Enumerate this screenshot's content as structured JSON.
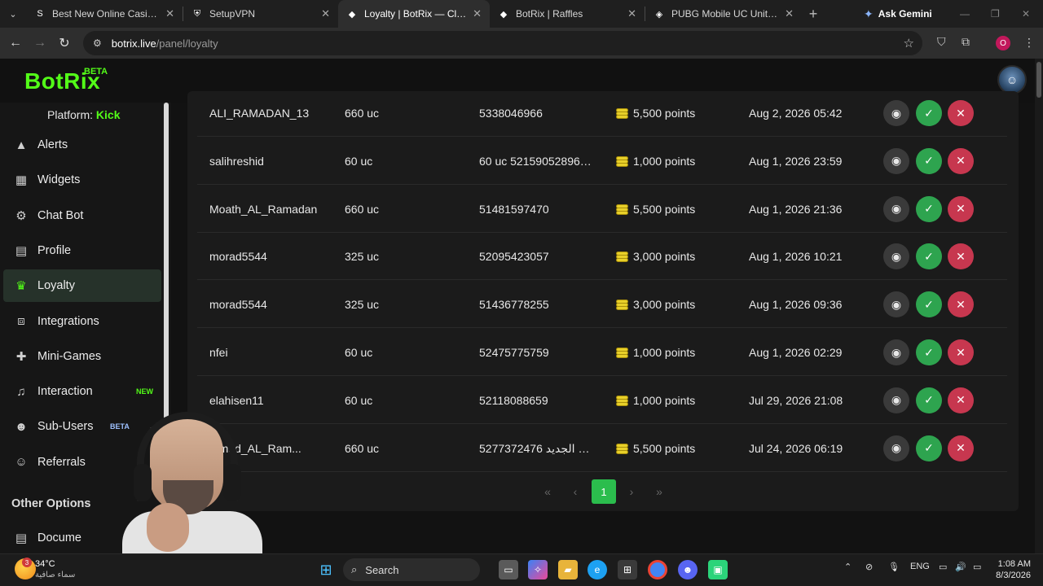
{
  "browser": {
    "tabs": [
      {
        "title": "Best New Online Casino G",
        "icon": "casino-s-icon",
        "active": false
      },
      {
        "title": "SetupVPN",
        "icon": "vpn-icon",
        "active": false
      },
      {
        "title": "Loyalty | BotRix — Cloud Strea",
        "icon": "botrix-icon",
        "active": true
      },
      {
        "title": "BotRix | Raffles",
        "icon": "botrix-icon",
        "active": false
      },
      {
        "title": "PUBG Mobile UC United Arab",
        "icon": "pubg-icon",
        "active": false
      }
    ],
    "gemini_label": "Ask Gemini",
    "url_host": "botrix.live",
    "url_path": "/panel/loyalty",
    "profile_initial": "O"
  },
  "app": {
    "logo": "BotRix",
    "logo_badge": "BETA",
    "platform_label": "Platform:",
    "platform_value": "Kick",
    "accent": "#53fc18"
  },
  "sidebar": {
    "items": [
      {
        "label": "Alerts",
        "icon": "warning-icon"
      },
      {
        "label": "Widgets",
        "icon": "grid-icon"
      },
      {
        "label": "Chat Bot",
        "icon": "robot-icon"
      },
      {
        "label": "Profile",
        "icon": "id-card-icon"
      },
      {
        "label": "Loyalty",
        "icon": "trophy-icon",
        "active": true
      },
      {
        "label": "Integrations",
        "icon": "puzzle-icon"
      },
      {
        "label": "Mini-Games",
        "icon": "gamepad-icon"
      },
      {
        "label": "Interaction",
        "icon": "music-icon",
        "badge": "NEW"
      },
      {
        "label": "Sub-Users",
        "icon": "users-icon",
        "badge": "BETA"
      },
      {
        "label": "Referrals",
        "icon": "people-icon"
      }
    ],
    "section_title": "Other Options",
    "docs_label": "Docume"
  },
  "redemptions": [
    {
      "user": "ALI_RAMADAN_13",
      "item": "660 uc",
      "note": "5338046966",
      "points": "5,500 points",
      "date": "Aug 2, 2026 05:42"
    },
    {
      "user": "salihreshid",
      "item": "60 uc",
      "note": "60 uc 52159052896 م...",
      "points": "1,000 points",
      "date": "Aug 1, 2026 23:59"
    },
    {
      "user": "Moath_AL_Ramadan",
      "item": "660 uc",
      "note": "51481597470",
      "points": "5,500 points",
      "date": "Aug 1, 2026 21:36"
    },
    {
      "user": "morad5544",
      "item": "325 uc",
      "note": "52095423057",
      "points": "3,000 points",
      "date": "Aug 1, 2026 10:21"
    },
    {
      "user": "morad5544",
      "item": "325 uc",
      "note": "51436778255",
      "points": "3,000 points",
      "date": "Aug 1, 2026 09:36"
    },
    {
      "user": "nfei",
      "item": "60 uc",
      "note": "52475775759",
      "points": "1,000 points",
      "date": "Aug 1, 2026 02:29"
    },
    {
      "user": "elahisen11",
      "item": "60 uc",
      "note": "52118088659",
      "points": "1,000 points",
      "date": "Jul 29, 2026 21:08"
    },
    {
      "user": "mmad_AL_Ram...",
      "item": "660 uc",
      "note": "5277372476 شراء الجديد...",
      "points": "5,500 points",
      "date": "Jul 24, 2026 06:19"
    }
  ],
  "pagination": {
    "first": "«",
    "prev": "‹",
    "current": "1",
    "next": "›",
    "last": "»"
  },
  "taskbar": {
    "temp": "34°C",
    "weather_sub": "سماء صافية",
    "weather_badge": "3",
    "search_label": "Search",
    "lang": "ENG",
    "time": "1:08 AM",
    "date": "8/3/2026"
  }
}
